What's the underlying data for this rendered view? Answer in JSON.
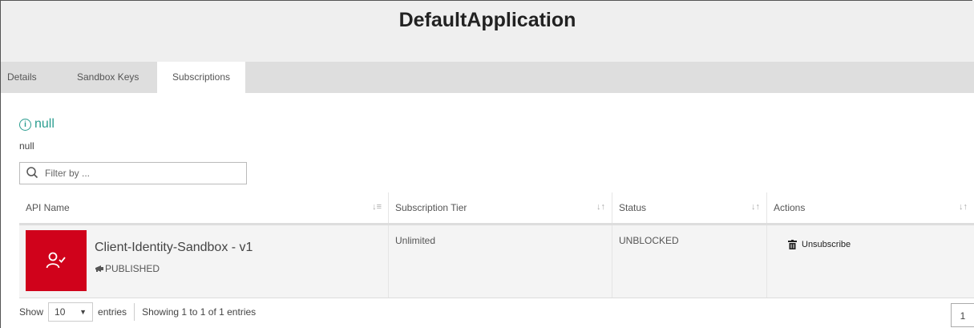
{
  "app": {
    "title": "DefaultApplication"
  },
  "tabs": [
    {
      "label": "Details",
      "active": false
    },
    {
      "label": "Sandbox Keys",
      "active": false
    },
    {
      "label": "Subscriptions",
      "active": true
    }
  ],
  "info": {
    "heading": "null",
    "text": "null"
  },
  "filter": {
    "placeholder": "Filter by ...",
    "value": ""
  },
  "table": {
    "columns": [
      "API Name",
      "Subscription Tier",
      "Status",
      "Actions"
    ],
    "rows": [
      {
        "api_name": "Client-Identity-Sandbox - v1",
        "api_status": "PUBLISHED",
        "tier": "Unlimited",
        "status": "UNBLOCKED",
        "action": "Unsubscribe"
      }
    ]
  },
  "pagination": {
    "show_label": "Show",
    "page_length": "10",
    "entries_label": "entries",
    "info": "Showing 1 to 1 of 1 entries",
    "current_page": "1"
  },
  "colors": {
    "accent": "#2a9d8f",
    "thumb": "#d0021b",
    "tabbar": "#dedede",
    "header": "#efefef"
  },
  "icons": [
    "info-icon",
    "search-icon",
    "sort-icon",
    "user-check-icon",
    "megaphone-icon",
    "trash-icon",
    "dropdown-arrow-icon"
  ]
}
